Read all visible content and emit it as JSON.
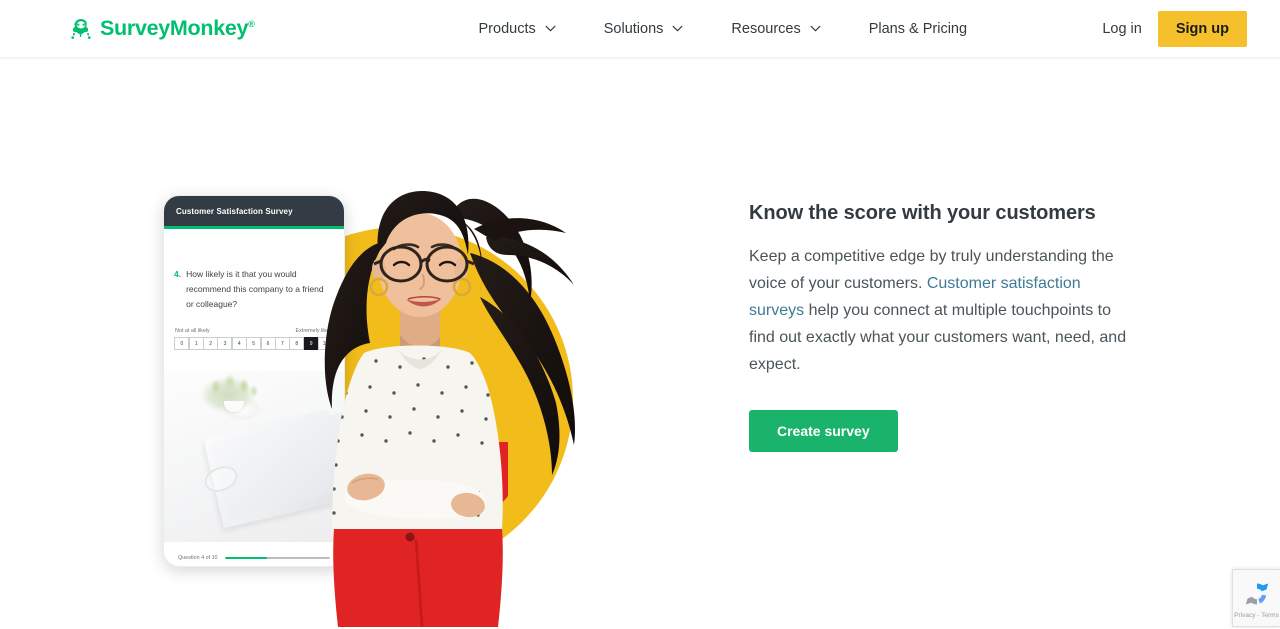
{
  "header": {
    "logo_text": "SurveyMonkey",
    "logo_tm": "®",
    "nav": [
      {
        "label": "Products",
        "has_chevron": true
      },
      {
        "label": "Solutions",
        "has_chevron": true
      },
      {
        "label": "Resources",
        "has_chevron": true
      },
      {
        "label": "Plans & Pricing",
        "has_chevron": false
      }
    ],
    "login_label": "Log in",
    "signup_label": "Sign up"
  },
  "hero": {
    "heading": "Know the score with your customers",
    "body_before_link": "Keep a competitive edge by truly understanding the voice of your customers. ",
    "link_text": "Customer satisfaction surveys",
    "body_after_link": " help you connect at multiple touchpoints to find out exactly what your customers want, need, and expect.",
    "cta_label": "Create survey"
  },
  "phone": {
    "survey_title": "Customer Satisfaction Survey",
    "question_number": "4.",
    "question_text": "How likely is it that you would recommend this company to a friend or colleague?",
    "scale_low_label": "Not at all likely",
    "scale_high_label": "Extremely likely",
    "scale_values": [
      "0",
      "1",
      "2",
      "3",
      "4",
      "5",
      "6",
      "7",
      "8",
      "9",
      "10"
    ],
    "selected_value": "9",
    "progress_label": "Question 4 of 10",
    "progress_percent": 40
  },
  "recaptcha": {
    "text": "Privacy - Terms"
  },
  "colors": {
    "brand_green": "#00bf6f",
    "cta_green": "#19b36b",
    "signup_yellow": "#f5c02b",
    "circle_yellow": "#f2bc1b",
    "skirt_red": "#e02323",
    "link_teal": "#3e7b96",
    "text_dark": "#333b40",
    "phone_header": "#333b44"
  }
}
